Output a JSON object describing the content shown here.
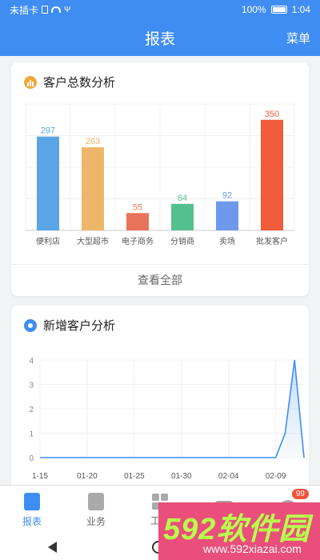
{
  "status_bar": {
    "carrier": "未插卡",
    "battery": "100%",
    "time": "1:04"
  },
  "nav": {
    "title": "报表",
    "menu": "菜单"
  },
  "card_customers": {
    "title": "客户总数分析",
    "see_all": "查看全部"
  },
  "card_new": {
    "title": "新增客户分析"
  },
  "chart_data": [
    {
      "type": "bar",
      "categories": [
        "便利店",
        "大型超市",
        "电子商务",
        "分销商",
        "卖场",
        "批发客户"
      ],
      "values": [
        297,
        263,
        55,
        84,
        92,
        350
      ],
      "colors": [
        "#5aa5e6",
        "#eeb66a",
        "#e8735b",
        "#55c08f",
        "#6e98ec",
        "#ef5b3b"
      ],
      "ylim": [
        0,
        400
      ],
      "grid": true
    },
    {
      "type": "line",
      "x": [
        "1-15",
        "1-16",
        "1-17",
        "1-18",
        "1-19",
        "01-20",
        "1-21",
        "1-22",
        "1-23",
        "1-24",
        "01-25",
        "1-26",
        "1-27",
        "1-28",
        "1-29",
        "01-30",
        "1-31",
        "2-01",
        "2-02",
        "2-03",
        "02-04",
        "2-05",
        "2-06",
        "2-07",
        "2-08",
        "02-09",
        "2-10",
        "2-11",
        "2-12"
      ],
      "values": [
        0,
        0,
        0,
        0,
        0,
        0,
        0,
        0,
        0,
        0,
        0,
        0,
        0,
        0,
        0,
        0,
        0,
        0,
        0,
        0,
        0,
        0,
        0,
        0,
        0,
        0,
        1,
        4,
        0
      ],
      "tick_labels": [
        "1-15",
        "01-20",
        "01-25",
        "01-30",
        "02-04",
        "02-09"
      ],
      "yticks": [
        0,
        1,
        2,
        3,
        4
      ],
      "ylim": [
        0,
        4
      ],
      "color": "#3f8df2",
      "grid": true
    }
  ],
  "tabs": [
    {
      "label": "报表",
      "active": true
    },
    {
      "label": "业务",
      "active": false
    },
    {
      "label": "工作",
      "active": false
    },
    {
      "label": "",
      "active": false
    },
    {
      "label": "",
      "active": false,
      "badge": "99"
    }
  ],
  "watermark": {
    "big": "592软件园",
    "small": "www.592xiazai.com"
  }
}
